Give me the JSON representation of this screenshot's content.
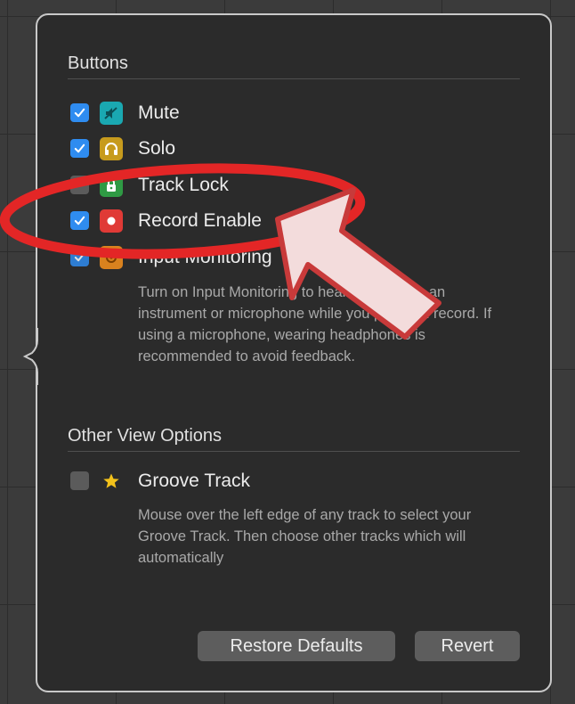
{
  "buttons_section": {
    "title": "Buttons",
    "items": [
      {
        "label": "Mute",
        "checked": true,
        "icon": "mute-icon",
        "color": "#1aa8b1"
      },
      {
        "label": "Solo",
        "checked": true,
        "icon": "headphones-icon",
        "color": "#c79b1d"
      },
      {
        "label": "Track Lock",
        "checked": false,
        "icon": "lock-icon",
        "color": "#2f9a44"
      },
      {
        "label": "Record Enable",
        "checked": true,
        "icon": "record-icon",
        "color": "#e03a36"
      },
      {
        "label": "Input Monitoring",
        "checked": true,
        "icon": "input-monitoring-icon",
        "color": "#d9821e"
      }
    ],
    "input_monitoring_description": "Turn on Input Monitoring to hear sound from an instrument or microphone while you play and record. If using a microphone, wearing headphones is recommended to avoid feedback."
  },
  "other_section": {
    "title": "Other View Options",
    "items": [
      {
        "label": "Groove Track",
        "checked": false,
        "icon": "star-icon",
        "color": "#f3c21b"
      }
    ],
    "groove_description": "Mouse over the left edge of any track to select your Groove Track. Then choose other tracks which will automatically"
  },
  "footer": {
    "restore_label": "Restore Defaults",
    "revert_label": "Revert"
  },
  "annotation": {
    "highlight_color": "#e32626",
    "arrow_fill": "#f3dcdc",
    "arrow_stroke": "#c83a3a"
  }
}
